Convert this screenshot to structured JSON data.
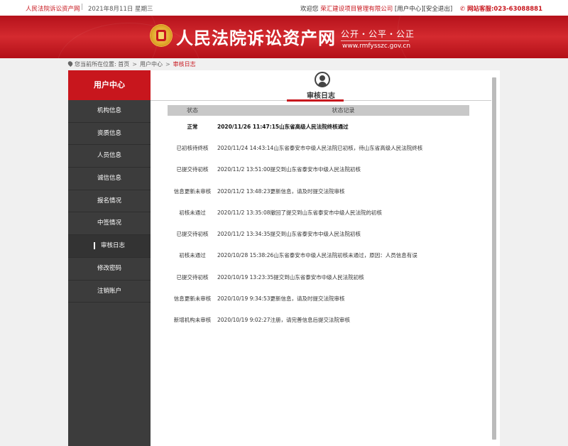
{
  "topbar": {
    "site_name": "人民法院诉讼资产网",
    "separator": "|",
    "date": "2021年8月11日  星期三",
    "welcome": "欢迎您",
    "company": "荣汇建设项目管理有限公司",
    "user_center_link": "[用户中心]",
    "logout_link": "[安全退出]",
    "hotline": "网站客服:023-63088881"
  },
  "banner": {
    "title": "人民法院诉讼资产网",
    "slogan": "公开・公平・公正",
    "url": "www.rmfysszc.gov.cn"
  },
  "breadcrumb": {
    "prefix": "您当前所在位置:",
    "items": [
      "首页",
      "用户中心",
      "审核日志"
    ],
    "arrow": ">"
  },
  "sidebar": {
    "header": "用户中心",
    "items": [
      {
        "label": "机构信息"
      },
      {
        "label": "资质信息"
      },
      {
        "label": "人员信息"
      },
      {
        "label": "诚信信息"
      },
      {
        "label": "报名情况"
      },
      {
        "label": "中签情况"
      },
      {
        "label": "审核日志",
        "active": true
      },
      {
        "label": "修改密码"
      },
      {
        "label": "注销账户"
      }
    ]
  },
  "main": {
    "tab_title": "审核日志",
    "columns": [
      "状态",
      "状态记录"
    ],
    "rows": [
      {
        "status": "正常",
        "record": "2020/11/26 11:47:15山东省高级人民法院终核通过",
        "bold": true
      },
      {
        "status": "已初核待终核",
        "record": "2020/11/24 14:43:14山东省泰安市中级人民法院已初核，待山东省高级人民法院终核"
      },
      {
        "status": "已提交待初核",
        "record": "2020/11/2 13:51:00提交到山东省泰安市中级人民法院初核"
      },
      {
        "status": "信息更新未审核",
        "record": "2020/11/2 13:48:23更新信息，请及时提交法院审核"
      },
      {
        "status": "初核未通过",
        "record": "2020/11/2 13:35:08撤回了提交到山东省泰安市中级人民法院的初核"
      },
      {
        "status": "已提交待初核",
        "record": "2020/11/2 13:34:35提交到山东省泰安市中级人民法院初核"
      },
      {
        "status": "初核未通过",
        "record": "2020/10/28 15:38:26山东省泰安市中级人民法院初核未通过，原因：人员信息有误"
      },
      {
        "status": "已提交待初核",
        "record": "2020/10/19 13:23:35提交到山东省泰安市中级人民法院初核"
      },
      {
        "status": "信息更新未审核",
        "record": "2020/10/19 9:34:53更新信息，请及时提交法院审核"
      },
      {
        "status": "新增机构未审核",
        "record": "2020/10/19 9:02:27注册，请完善信息后提交法院审核"
      }
    ]
  },
  "colors": {
    "brand_red": "#c8161d",
    "sidebar_bg": "#3c3c3c"
  }
}
